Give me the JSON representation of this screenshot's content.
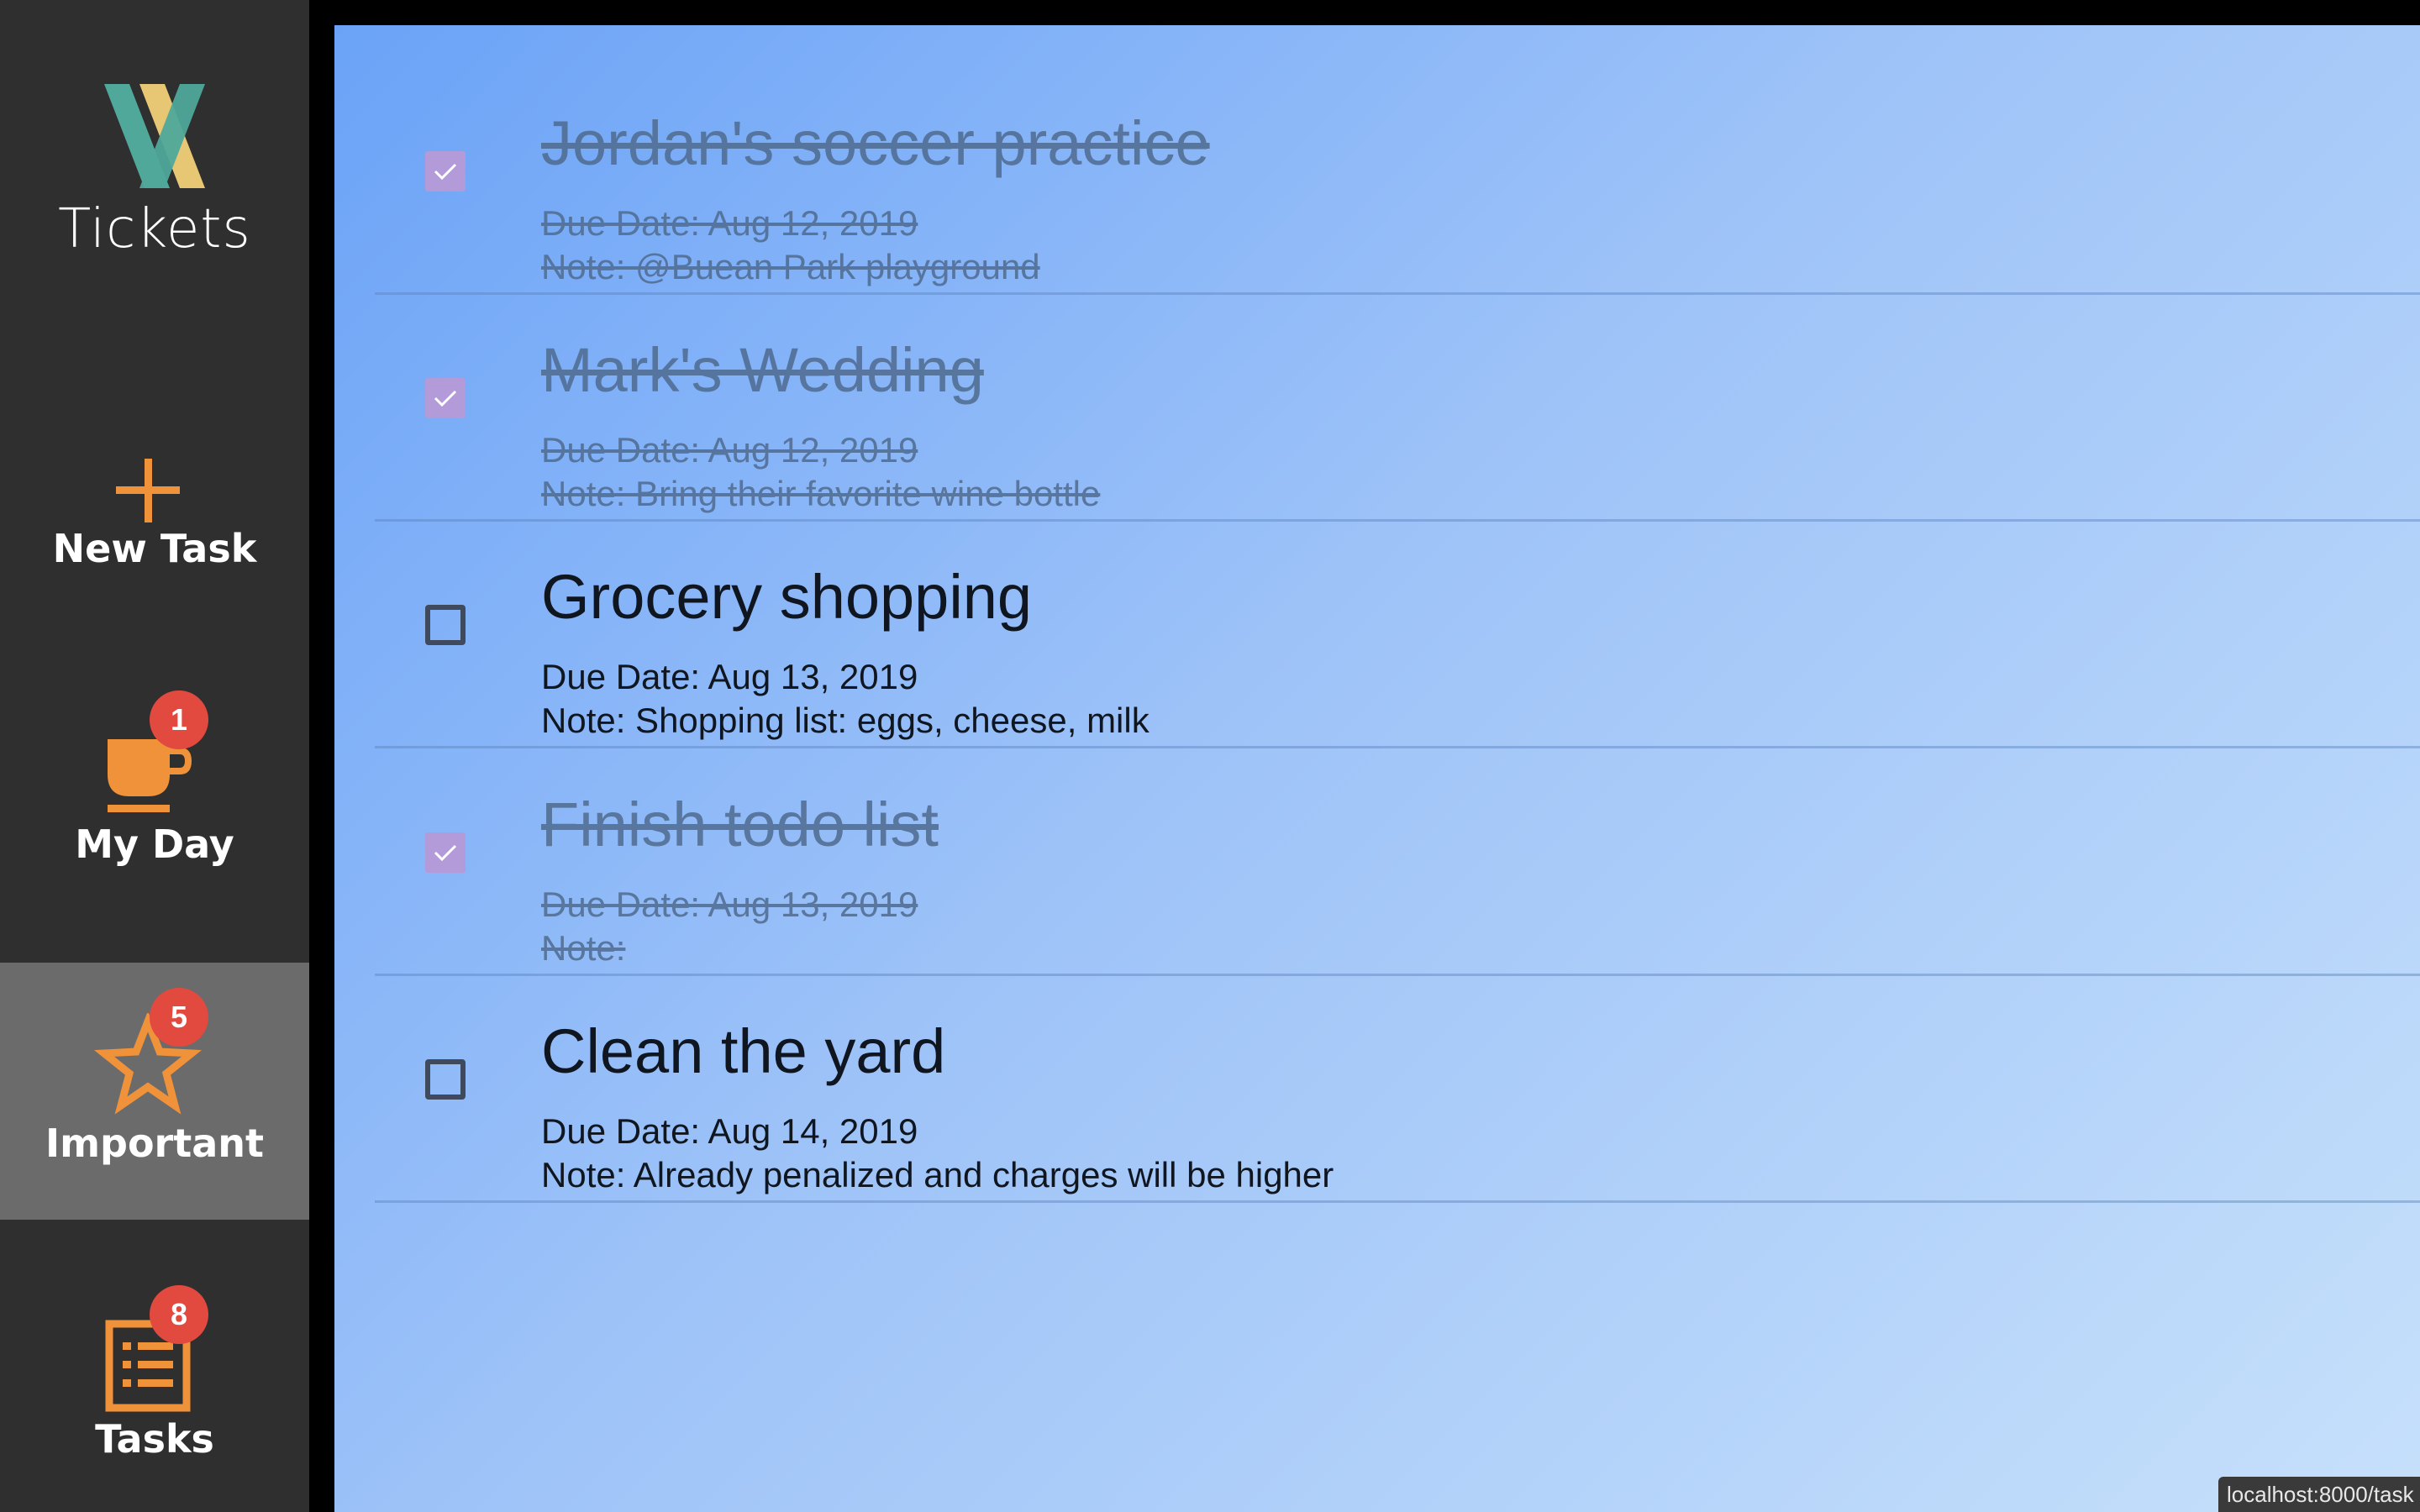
{
  "app": {
    "brand_name": "Tickets",
    "logo_icon": "x-logo-icon"
  },
  "colors": {
    "sidebar_bg": "#2f2f2f",
    "sidebar_active_bg": "#6b6b6b",
    "accent_orange": "#f0923a",
    "badge_red": "#e24a3f",
    "checkbox_checked": "#b39ad8",
    "gradient_start": "#6ba3f7",
    "gradient_end": "#c6e0fb"
  },
  "sidebar": {
    "items": [
      {
        "label": "New Task",
        "icon": "plus-icon",
        "active": false
      },
      {
        "label": "My Day",
        "icon": "coffee-cup-icon",
        "badge": "1",
        "active": false
      },
      {
        "label": "Important",
        "icon": "star-icon",
        "badge": "5",
        "active": true
      },
      {
        "label": "Tasks",
        "icon": "list-icon",
        "badge": "8",
        "active": false
      }
    ]
  },
  "tasks": [
    {
      "title": "Jordan's soccer practice",
      "due": "Due Date: Aug 12, 2019",
      "note": "Note: @Buean Park playground",
      "completed": true
    },
    {
      "title": "Mark's Wedding",
      "due": "Due Date: Aug 12, 2019",
      "note": "Note: Bring their favorite wine bottle",
      "completed": true
    },
    {
      "title": "Grocery shopping",
      "due": "Due Date: Aug 13, 2019",
      "note": "Note: Shopping list: eggs, cheese, milk",
      "completed": false
    },
    {
      "title": "Finish todo list",
      "due": "Due Date: Aug 13, 2019",
      "note": "Note:",
      "completed": true
    },
    {
      "title": "Clean the yard",
      "due": "Due Date: Aug 14, 2019",
      "note": "Note: Already penalized and charges will be higher",
      "completed": false
    }
  ],
  "status_bar": {
    "url": "localhost:8000/task"
  }
}
